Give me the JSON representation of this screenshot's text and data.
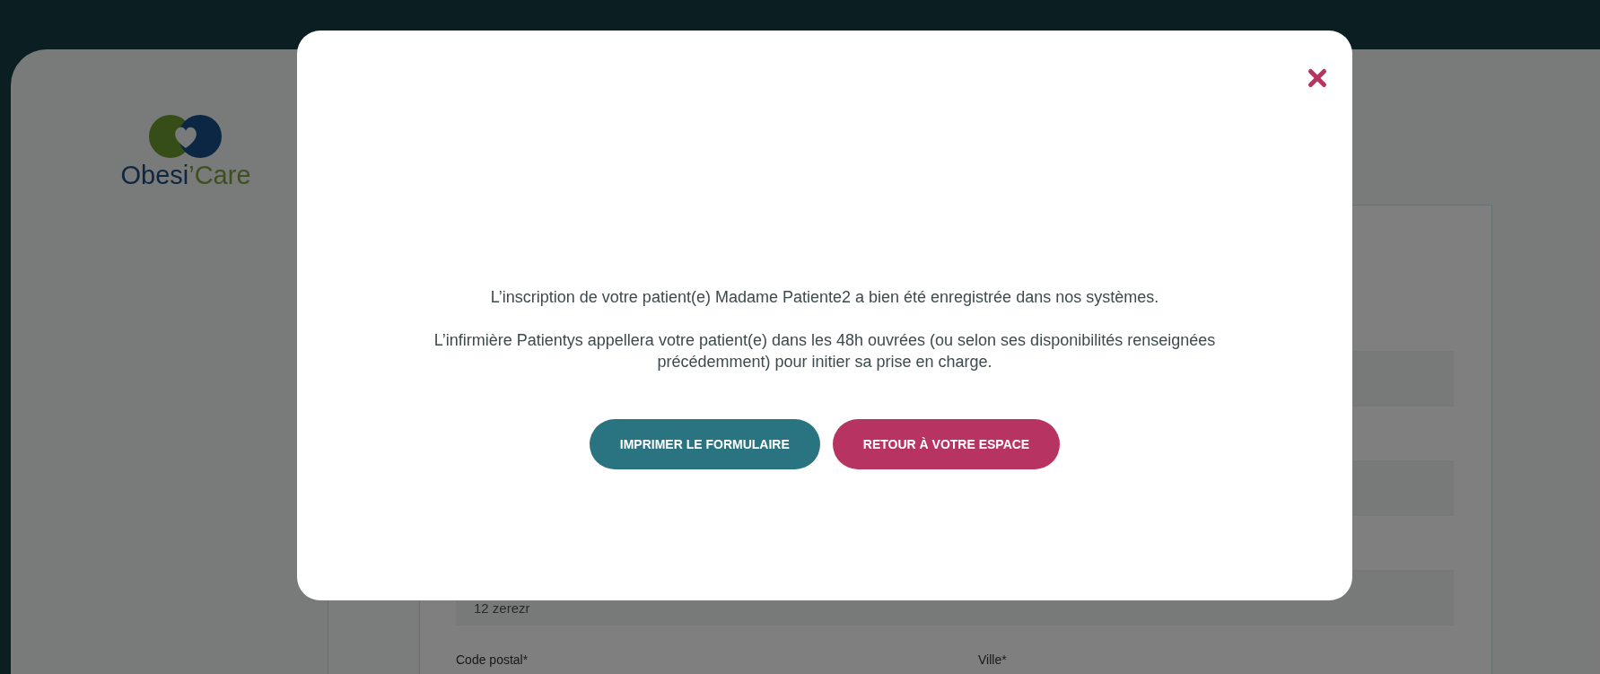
{
  "logo": {
    "wordmark": [
      "Obesi",
      "’Care"
    ]
  },
  "form": {
    "address_value": "12 zerezr",
    "labels": [
      "Code postal*",
      "Ville*"
    ]
  },
  "modal": {
    "messages": [
      "L’inscription de votre patient(e) Madame Patiente2 a bien été enregistrée dans nos systèmes.",
      "L’infirmière Patientys appellera votre patient(e) dans les 48h ouvrées (ou selon ses disponibilités renseignées précédemment) pour initier sa prise en charge."
    ],
    "buttons": [
      {
        "label": "IMPRIMER LE FORMULAIRE",
        "kind": "primary"
      },
      {
        "label": "RETOUR À VOTRE ESPACE",
        "kind": "secondary"
      }
    ]
  }
}
